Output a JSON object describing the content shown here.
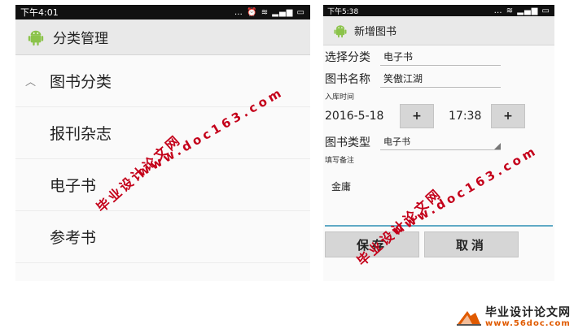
{
  "left_screen": {
    "status_time": "下午4:01",
    "status_icons": "… ⏰ ≋ ▂▄▆ ▭",
    "app_title": "分类管理",
    "categories": [
      {
        "label": "图书分类",
        "expanded": true
      },
      {
        "label": "报刊杂志"
      },
      {
        "label": "电子书"
      },
      {
        "label": "参考书"
      }
    ]
  },
  "right_screen": {
    "status_time": "下午5:38",
    "status_icons": "… ≋ ▂▄▆ ▭",
    "app_title": "新增图书",
    "category_label": "选择分类",
    "category_value": "电子书",
    "name_label": "图书名称",
    "name_value": "笑傲江湖",
    "date_label": "入库时间",
    "date_value": "2016-5-18",
    "time_value": "17:38",
    "plus_label": "+",
    "type_label": "图书类型",
    "type_value": "电子书",
    "remark_label": "填写备注",
    "remark_value": "金庸",
    "save_label": "保存",
    "cancel_label": "取消"
  },
  "watermarks": {
    "site_cn": "毕业设计论文网",
    "site_url": "www.doc163.com"
  },
  "footer_logo": {
    "name": "毕业设计论文网",
    "url": "www.56doc.com"
  },
  "colors": {
    "watermark": "#c4001a",
    "logo_url": "#e05a00",
    "focus_underline": "#5fa9c5"
  }
}
